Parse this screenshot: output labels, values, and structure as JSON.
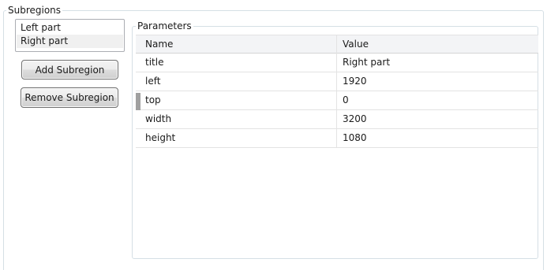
{
  "subregions": {
    "legend": "Subregions",
    "items": [
      {
        "label": "Left part"
      },
      {
        "label": "Right part"
      }
    ],
    "selected_index": 1
  },
  "buttons": {
    "add": "Add Subregion",
    "remove": "Remove Subregion"
  },
  "parameters": {
    "legend": "Parameters",
    "columns": {
      "name": "Name",
      "value": "Value"
    },
    "rows": [
      {
        "name": "title",
        "value": "Right part"
      },
      {
        "name": "left",
        "value": "1920"
      },
      {
        "name": "top",
        "value": "0"
      },
      {
        "name": "width",
        "value": "3200"
      },
      {
        "name": "height",
        "value": "1080"
      }
    ],
    "current_row_index": 2
  }
}
